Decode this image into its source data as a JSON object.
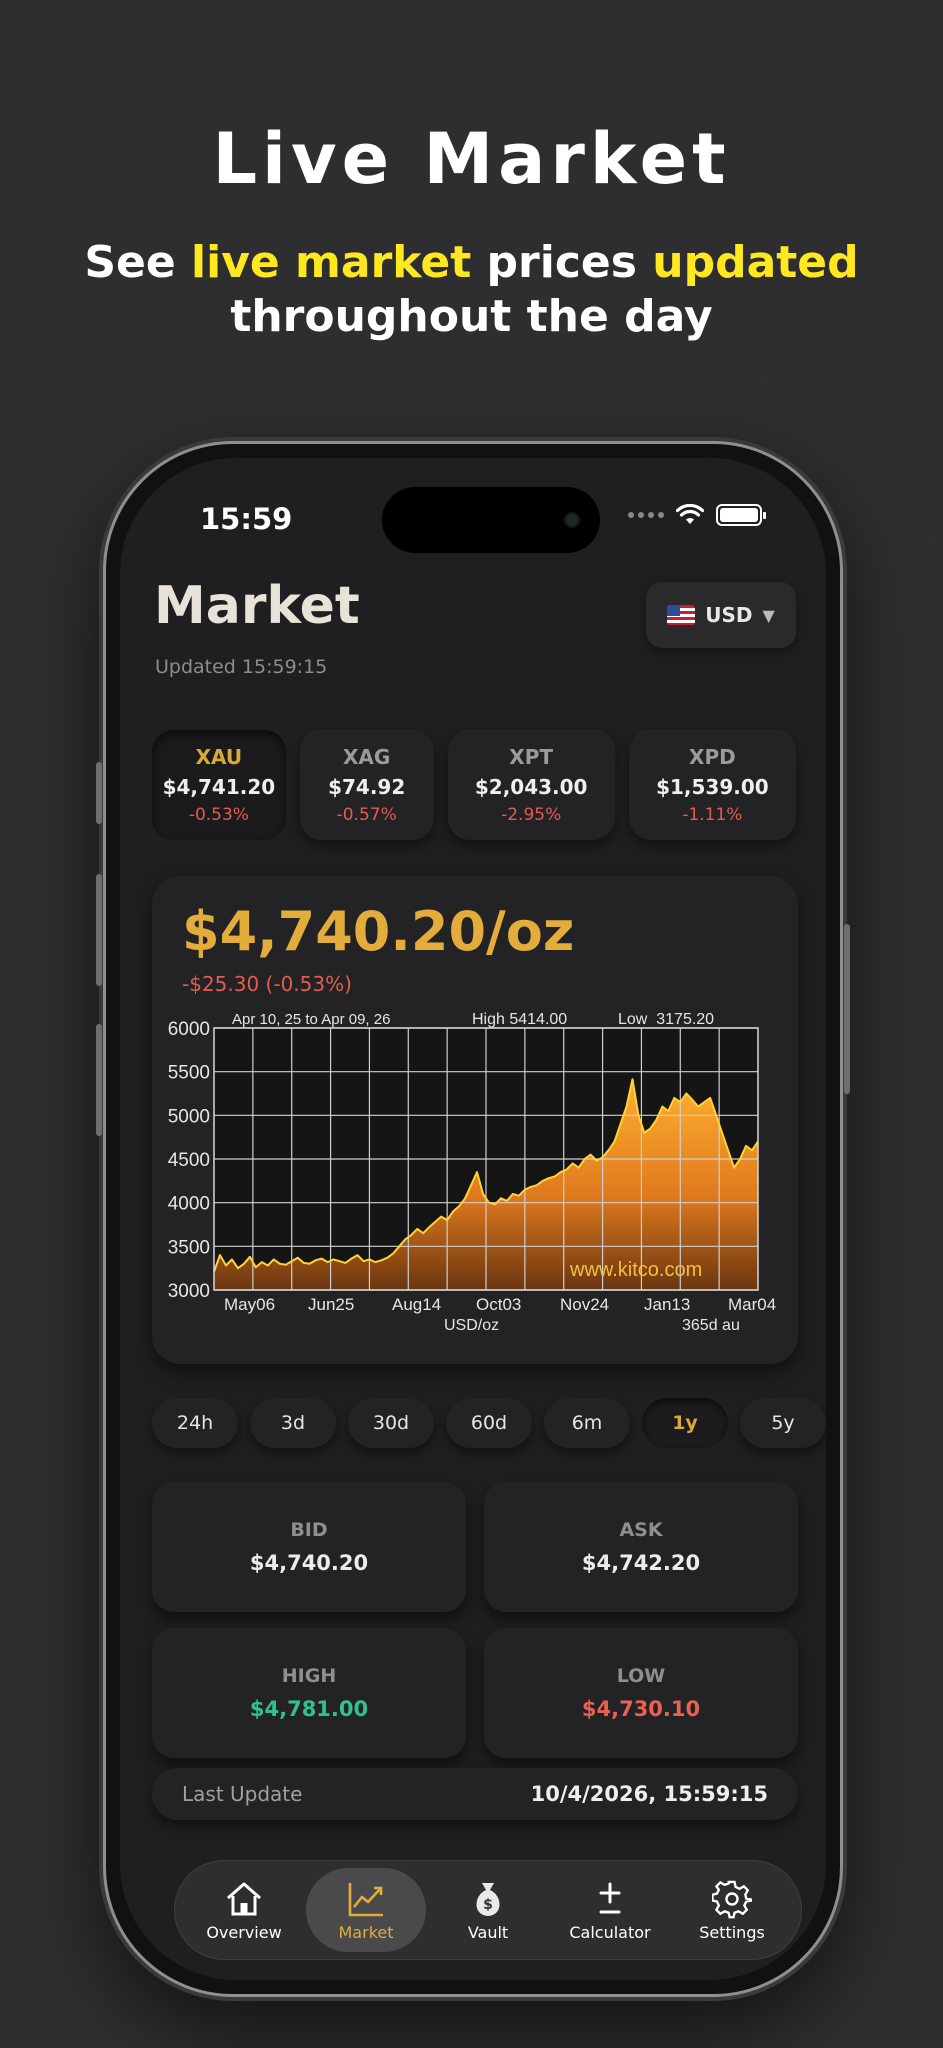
{
  "promo": {
    "title": "Live Market",
    "sub_1": "See ",
    "sub_hl_1": "live market",
    "sub_2": " prices ",
    "sub_hl_2": "updated",
    "sub_3": "throughout the day"
  },
  "status_bar": {
    "time": "15:59"
  },
  "header": {
    "title": "Market",
    "updated": "Updated 15:59:15",
    "currency": "USD"
  },
  "metals": [
    {
      "symbol": "XAU",
      "price": "$4,741.20",
      "change": "-0.53%"
    },
    {
      "symbol": "XAG",
      "price": "$74.92",
      "change": "-0.57%"
    },
    {
      "symbol": "XPT",
      "price": "$2,043.00",
      "change": "-2.95%"
    },
    {
      "symbol": "XPD",
      "price": "$1,539.00",
      "change": "-1.11%"
    }
  ],
  "selected_metal": {
    "price": "$4,740.20/oz",
    "change": "-$25.30 (-0.53%)"
  },
  "chart_data": {
    "type": "area",
    "range_text": "Apr 10, 25 to Apr 09, 26",
    "high_text": "High 5414.00",
    "low_text": "Low  3175.20",
    "watermark": "www.kitco.com",
    "unit": "USD/oz",
    "span": "365d au",
    "ylim": [
      3000,
      6000
    ],
    "yticks": [
      3000,
      3500,
      4000,
      4500,
      5000,
      5500,
      6000
    ],
    "xticks": [
      "May06",
      "Jun25",
      "Aug14",
      "Oct03",
      "Nov24",
      "Jan13",
      "Mar04"
    ],
    "x": [
      0,
      4,
      8,
      12,
      16,
      20,
      24,
      28,
      32,
      36,
      40,
      44,
      48,
      52,
      56,
      60,
      64,
      68,
      72,
      76,
      80,
      84,
      88,
      92,
      96,
      100,
      104,
      108,
      112,
      116,
      120,
      124,
      128,
      132,
      136,
      140,
      144,
      148,
      152,
      156,
      160,
      164,
      168,
      172,
      176,
      180,
      184,
      188,
      192,
      196,
      200,
      204,
      208,
      212,
      216,
      220,
      224,
      228,
      232,
      236,
      240,
      244,
      248,
      252,
      256,
      260,
      264,
      268,
      272,
      276,
      280,
      284,
      288,
      292,
      296,
      300,
      304,
      308,
      312,
      316,
      320,
      324,
      328,
      332,
      336,
      340,
      344,
      348,
      352,
      356,
      360,
      364
    ],
    "values": [
      3210,
      3400,
      3280,
      3350,
      3250,
      3300,
      3380,
      3260,
      3320,
      3280,
      3350,
      3300,
      3290,
      3330,
      3370,
      3310,
      3300,
      3340,
      3360,
      3320,
      3350,
      3330,
      3310,
      3360,
      3400,
      3330,
      3350,
      3320,
      3340,
      3370,
      3420,
      3500,
      3580,
      3630,
      3700,
      3650,
      3720,
      3780,
      3840,
      3800,
      3900,
      3960,
      4050,
      4200,
      4350,
      4100,
      4000,
      3980,
      4050,
      4020,
      4100,
      4080,
      4150,
      4180,
      4200,
      4250,
      4280,
      4300,
      4350,
      4380,
      4450,
      4400,
      4500,
      4550,
      4480,
      4520,
      4600,
      4700,
      4900,
      5100,
      5414,
      5000,
      4800,
      4850,
      4950,
      5100,
      5050,
      5200,
      5150,
      5250,
      5180,
      5100,
      5150,
      5200,
      5000,
      4800,
      4600,
      4400,
      4500,
      4650,
      4600,
      4700
    ]
  },
  "ranges": [
    "24h",
    "3d",
    "30d",
    "60d",
    "6m",
    "1y",
    "5y"
  ],
  "active_range": "1y",
  "stats": {
    "bid_label": "BID",
    "bid": "$4,740.20",
    "ask_label": "ASK",
    "ask": "$4,742.20",
    "high_label": "HIGH",
    "high": "$4,781.00",
    "low_label": "LOW",
    "low": "$4,730.10"
  },
  "last_update": {
    "label": "Last Update",
    "value": "10/4/2026, 15:59:15"
  },
  "tabs": [
    {
      "label": "Overview",
      "icon": "house-icon"
    },
    {
      "label": "Market",
      "icon": "chart-up-icon"
    },
    {
      "label": "Vault",
      "icon": "money-bag-icon"
    },
    {
      "label": "Calculator",
      "icon": "plus-minus-icon"
    },
    {
      "label": "Settings",
      "icon": "gear-icon"
    }
  ],
  "colors": {
    "accent_gold": "#e2ad3a",
    "negative": "#e45b4f",
    "positive": "#2fc38b",
    "highlight_yellow": "#ffe81f"
  }
}
